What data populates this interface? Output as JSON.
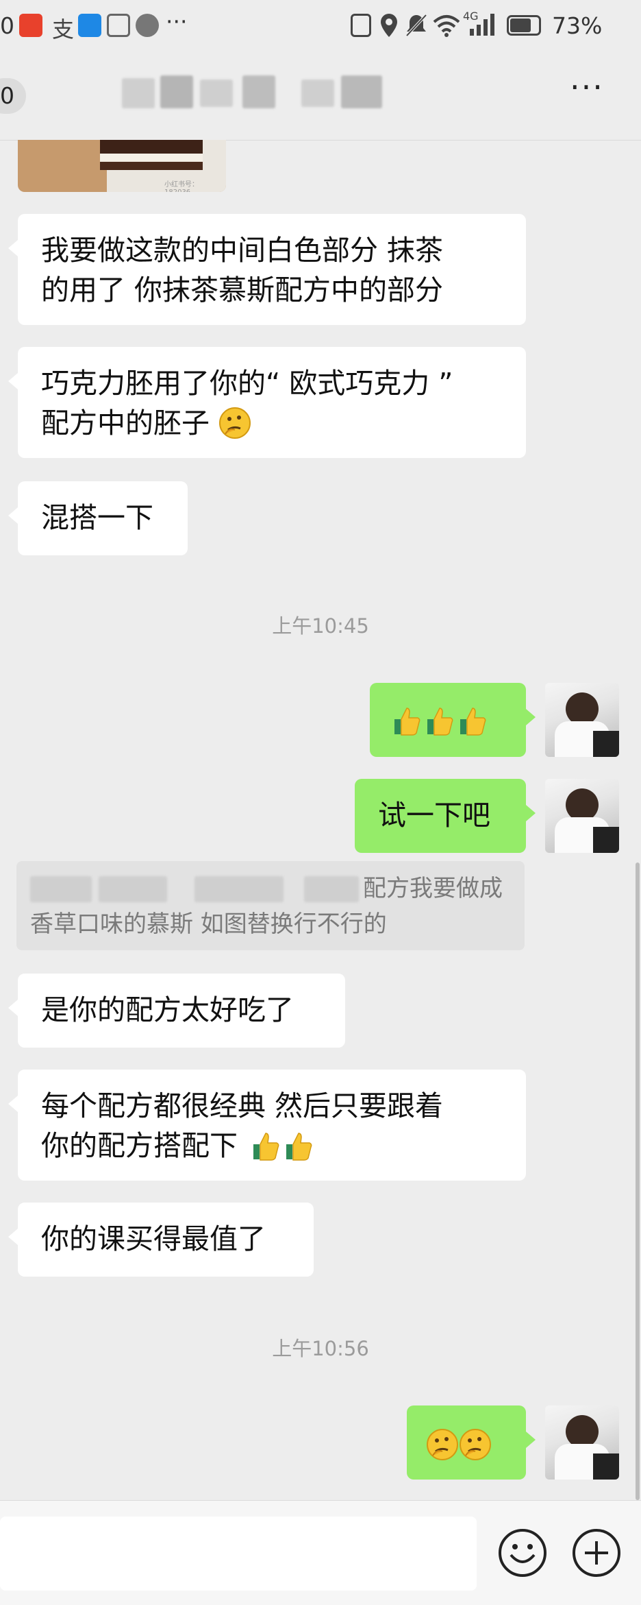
{
  "status_bar": {
    "left_fragment": "0",
    "app_icons": [
      "taobao-icon",
      "alipay-icon",
      "search-app-icon",
      "hand-icon",
      "wechat-icon"
    ],
    "more": "···",
    "network": "4G",
    "battery": "73%"
  },
  "header": {
    "back_count": "0",
    "more_label": "···"
  },
  "messages": [
    {
      "side": "left",
      "text_lines": [
        "我要做这款的中间白色部分 抹茶",
        "的用了 你抹茶慕斯配方中的部分"
      ]
    },
    {
      "side": "left",
      "text_lines": [
        "巧克力胚用了你的“ 欧式巧克力 ”",
        "配方中的胚子"
      ],
      "emoji": "thinking-face"
    },
    {
      "side": "left",
      "text": "混搭一下"
    },
    {
      "side": "right",
      "emoji": [
        "thumbs-up",
        "thumbs-up",
        "thumbs-up"
      ]
    },
    {
      "side": "right",
      "text": "试一下吧"
    },
    {
      "side": "left",
      "text": "是你的配方太好吃了"
    },
    {
      "side": "left",
      "text_lines": [
        "每个配方都很经典 然后只要跟着",
        "你的配方搭配下"
      ],
      "emoji": [
        "thumbs-up",
        "thumbs-up"
      ]
    },
    {
      "side": "left",
      "text": "你的课买得最值了"
    },
    {
      "side": "right",
      "emoji": [
        "thinking-face",
        "thinking-face"
      ]
    }
  ],
  "timestamps": [
    "上午10:45",
    "上午10:56"
  ],
  "quote": {
    "line1_visible": "配方我要做成",
    "line2": "香草口味的慕斯 如图替换行不行的"
  },
  "image_caption": "小红书号：182036..."
}
